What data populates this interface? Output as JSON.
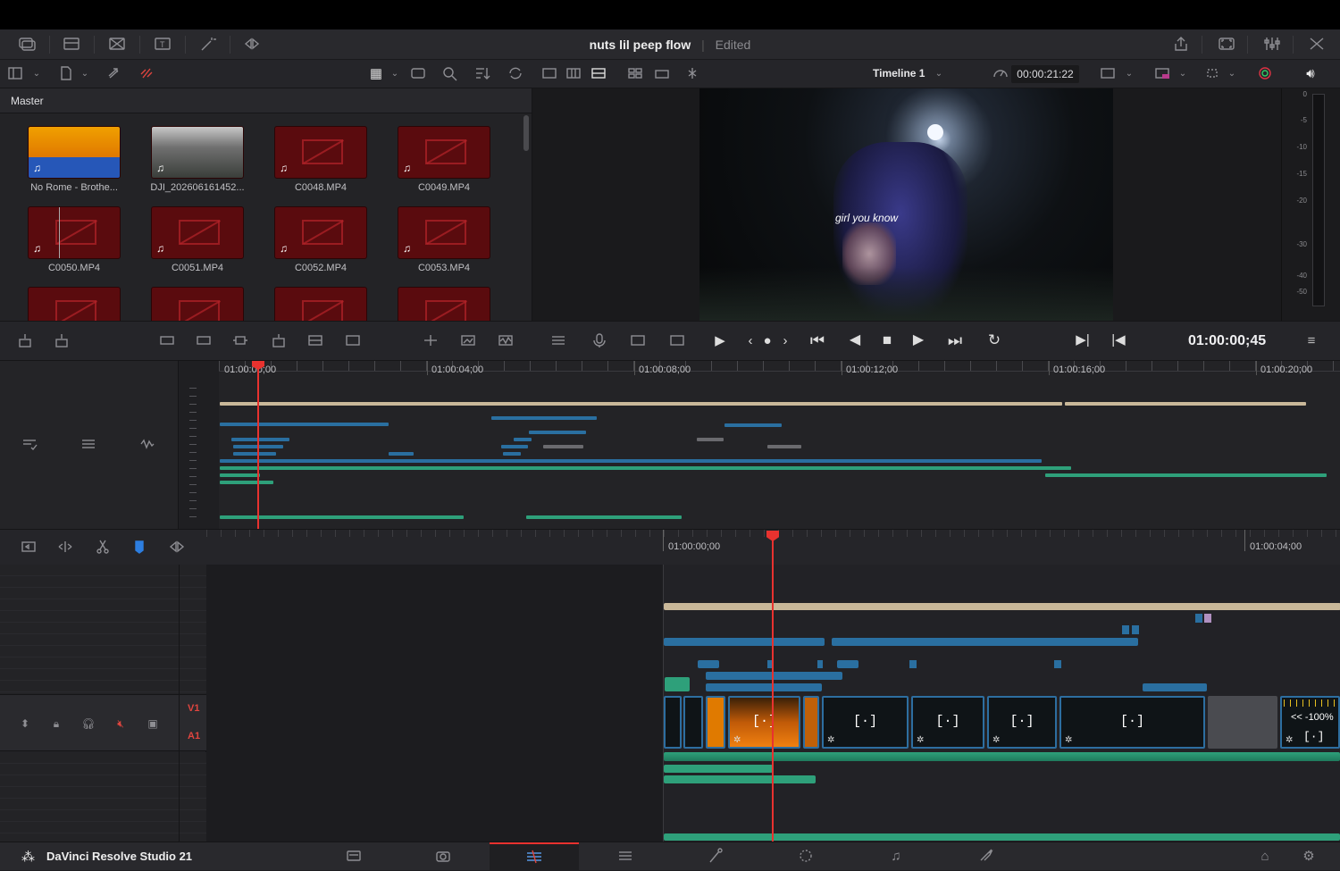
{
  "window": {
    "title": "nuts lil peep flow",
    "status": "Edited"
  },
  "mediapool": {
    "label": "Master",
    "clips": [
      {
        "name": "No Rome - Brothe...",
        "kind": "audio-art"
      },
      {
        "name": "DJI_202606161452...",
        "kind": "photo"
      },
      {
        "name": "C0048.MP4",
        "kind": "offline"
      },
      {
        "name": "C0049.MP4",
        "kind": "offline"
      },
      {
        "name": "C0050.MP4",
        "kind": "offline"
      },
      {
        "name": "C0051.MP4",
        "kind": "offline"
      },
      {
        "name": "C0052.MP4",
        "kind": "offline"
      },
      {
        "name": "C0053.MP4",
        "kind": "offline"
      }
    ]
  },
  "viewer": {
    "timeline_name": "Timeline 1",
    "source_timecode": "00:00:21:22",
    "subtitle": "girl you know",
    "current_timecode": "01:00:00;45",
    "meter_scale": [
      "0",
      "-5",
      "-10",
      "-15",
      "-20",
      "-30",
      "-40",
      "-50"
    ]
  },
  "minitimeline": {
    "ruler": [
      "01:00:00;00",
      "01:00:04;00",
      "01:00:08;00",
      "01:00:12;00",
      "01:00:16;00",
      "01:00:20;00"
    ]
  },
  "timeline": {
    "ruler": [
      "01:00:00;00",
      "01:00:04;00"
    ],
    "tracks": {
      "video": "V1",
      "audio": "A1"
    },
    "speed_label": "<< -100%"
  },
  "app": {
    "name": "DaVinci Resolve Studio 21"
  },
  "colors": {
    "accent": "#e23a3a",
    "clip_blue": "#2a6fa0",
    "audio_green": "#2ea07a",
    "playhead": "#e8322f"
  }
}
